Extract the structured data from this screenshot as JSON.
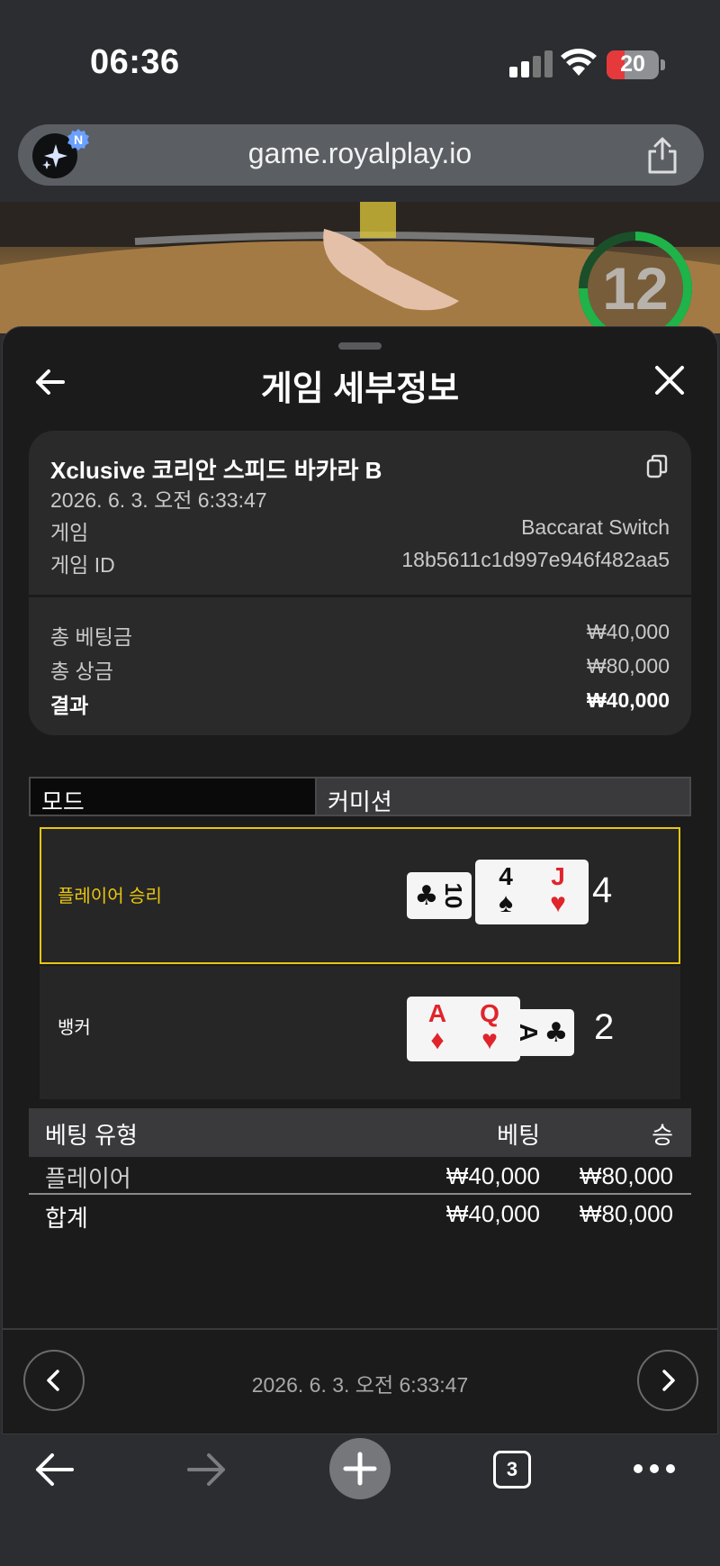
{
  "status_bar": {
    "time": "06:36",
    "battery": "20"
  },
  "browser": {
    "url": "game.royalplay.io",
    "badge": "N",
    "tab_count": "3"
  },
  "game": {
    "timer": "12"
  },
  "sheet": {
    "title": "게임 세부정보",
    "game_name": "Xclusive 코리안 스피드 바카라 B",
    "date": "2026. 6. 3. 오전 6:33:47",
    "rows": [
      {
        "label": "게임",
        "value": "Baccarat Switch"
      },
      {
        "label": "게임 ID",
        "value": "18b5611c1d997e946f482aa5"
      }
    ],
    "totals": [
      {
        "label": "총 베팅금",
        "value": "₩40,000"
      },
      {
        "label": "총 상금",
        "value": "₩80,000"
      },
      {
        "label": "결과",
        "value": "₩40,000"
      }
    ],
    "mode": {
      "left": "모드",
      "right": "커미션"
    },
    "results": {
      "player": {
        "label": "플레이어 승리",
        "score": "4",
        "cards": [
          {
            "rank": "10",
            "suit": "♣",
            "color": "black",
            "rotated": true
          },
          {
            "rank": "4",
            "suit": "♠",
            "color": "black",
            "rotated": false
          },
          {
            "rank": "J",
            "suit": "♥",
            "color": "red",
            "rotated": false
          }
        ]
      },
      "banker": {
        "label": "뱅커",
        "score": "2",
        "cards": [
          {
            "rank": "A",
            "suit": "♦",
            "color": "red",
            "rotated": false
          },
          {
            "rank": "Q",
            "suit": "♥",
            "color": "red",
            "rotated": false
          },
          {
            "rank": "A",
            "suit": "♣",
            "color": "black",
            "rotated": true
          }
        ]
      }
    },
    "bet_table": {
      "headers": [
        "베팅 유형",
        "베팅",
        "승"
      ],
      "rows": [
        {
          "type": "플레이어",
          "bet": "₩40,000",
          "win": "₩80,000"
        }
      ],
      "total": {
        "type": "합계",
        "bet": "₩40,000",
        "win": "₩80,000"
      }
    },
    "footer_date": "2026. 6. 3. 오전 6:33:47"
  },
  "colors": {
    "highlight": "#e8c60f",
    "player_label": "#e8c60f",
    "timer_ring": "#1fb34a"
  }
}
